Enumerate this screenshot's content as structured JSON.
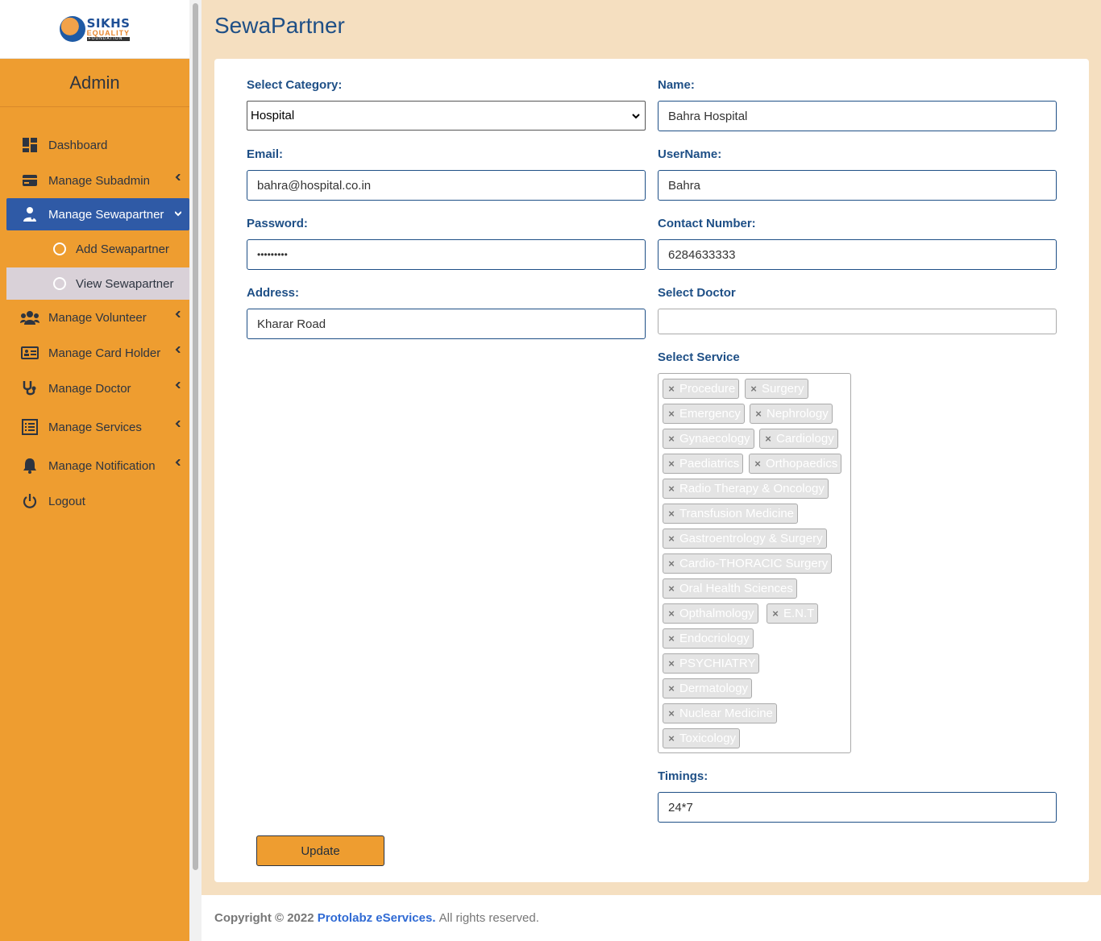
{
  "logo": {
    "line1": "SIKHS",
    "line2": "EQUALITY",
    "line3": "FOUNDATION"
  },
  "sidebar": {
    "user": "Admin",
    "items": [
      {
        "label": "Dashboard",
        "icon": "dashboard-icon"
      },
      {
        "label": "Manage Subadmin",
        "icon": "card-icon"
      },
      {
        "label": "Manage Sewapartner",
        "icon": "user-doctor-icon"
      },
      {
        "label": "Manage Volunteer",
        "icon": "users-icon"
      },
      {
        "label": "Manage Card Holder",
        "icon": "id-card-icon"
      },
      {
        "label": "Manage Doctor",
        "icon": "stethoscope-icon"
      },
      {
        "label": "Manage Services",
        "icon": "list-icon"
      },
      {
        "label": "Manage Notification",
        "icon": "bell-icon"
      },
      {
        "label": "Logout",
        "icon": "power-icon"
      }
    ],
    "subitems": [
      {
        "label": "Add Sewapartner"
      },
      {
        "label": "View Sewapartner"
      }
    ]
  },
  "page": {
    "title": "SewaPartner"
  },
  "form": {
    "category_label": "Select Category:",
    "category_value": "Hospital",
    "name_label": "Name:",
    "name_value": "Bahra Hospital",
    "email_label": "Email:",
    "email_value": "bahra@hospital.co.in",
    "username_label": "UserName:",
    "username_value": "Bahra",
    "password_label": "Password:",
    "password_value": "•••••••••",
    "contact_label": "Contact Number:",
    "contact_value": "6284633333",
    "address_label": "Address:",
    "address_value": "Kharar Road",
    "doctor_label": "Select Doctor",
    "doctor_value": "",
    "service_label": "Select Service",
    "services": [
      "Procedure",
      "Surgery",
      "Emergency",
      "Nephrology",
      "Gynaecology",
      "Cardiology",
      "Paediatrics",
      "Orthopaedics",
      "Radio Therapy & Oncology",
      "Transfusion Medicine",
      "Gastroentrology & Surgery",
      "Cardio-THORACIC Surgery",
      "Oral Health Sciences",
      "Opthalmology",
      "E.N.T",
      "Endocriology",
      "PSYCHIATRY",
      "Dermatology",
      "Nuclear Medicine",
      "Toxicology"
    ],
    "timings_label": "Timings:",
    "timings_value": "24*7",
    "update_label": "Update"
  },
  "footer": {
    "copyright": "Copyright © 2022",
    "brand": "Protolabz eServices.",
    "rights": "All rights reserved."
  },
  "colors": {
    "sidebar": "#ee9d30",
    "active": "#2f5aa6",
    "label": "#1e4f86",
    "background": "#f5dfc0"
  }
}
